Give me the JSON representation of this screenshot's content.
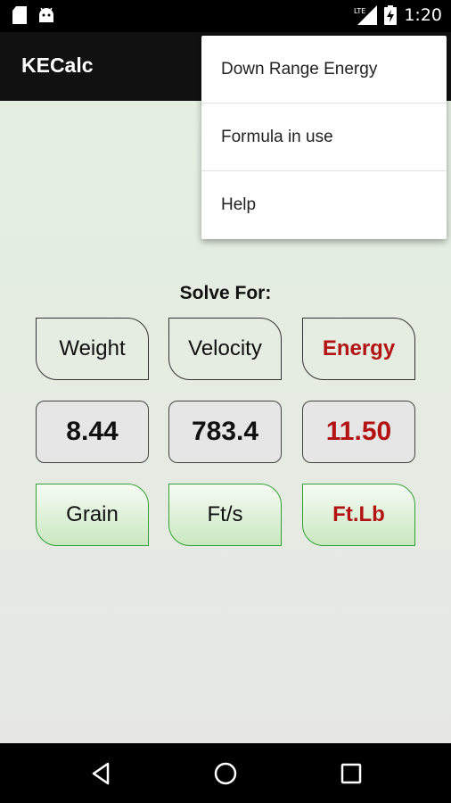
{
  "status": {
    "time": "1:20",
    "network": "LTE"
  },
  "app": {
    "title": "KECalc"
  },
  "menu": {
    "items": [
      "Down Range Energy",
      "Formula in use",
      "Help"
    ]
  },
  "solver": {
    "heading": "Solve For:",
    "options": [
      "Weight",
      "Velocity",
      "Energy"
    ],
    "selected": "Energy",
    "values": [
      "8.44",
      "783.4",
      "11.50"
    ],
    "units": [
      "Grain",
      "Ft/s",
      "Ft.Lb"
    ]
  },
  "colors": {
    "accent": "#b31313",
    "unit_border": "#33a033",
    "app_bar": "#111111"
  }
}
